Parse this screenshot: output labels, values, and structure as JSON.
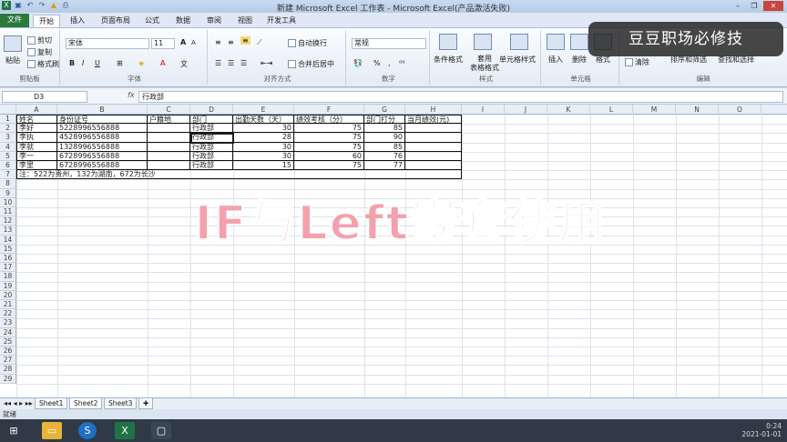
{
  "window": {
    "title": "新建 Microsoft Excel 工作表 - Microsoft Excel(产品激活失败)",
    "controls": [
      "–",
      "❐",
      "✕"
    ]
  },
  "ribbon_tabs": [
    "文件",
    "开始",
    "插入",
    "页面布局",
    "公式",
    "数据",
    "审阅",
    "视图",
    "开发工具"
  ],
  "ribbon": {
    "clipboard": {
      "paste": "粘贴",
      "cut": "剪切",
      "copy": "复制",
      "format_painter": "格式刷",
      "label": "剪贴板"
    },
    "font": {
      "name": "宋体",
      "size": "11",
      "label": "字体",
      "bold": "B",
      "italic": "I",
      "underline": "U",
      "grow": "A",
      "shrink": "A",
      "font_color": "A",
      "wen": "文"
    },
    "alignment": {
      "wrap": "自动换行",
      "merge": "合并后居中",
      "label": "对齐方式"
    },
    "number": {
      "format": "常规",
      "percent": "%",
      "comma": ",",
      "label": "数字"
    },
    "styles": {
      "cond": "条件格式",
      "table": "套用\n表格格式",
      "cell": "单元格样式",
      "label": "样式"
    },
    "cells": {
      "insert": "插入",
      "delete": "删除",
      "format": "格式",
      "label": "单元格"
    },
    "editing": {
      "clear": "清除",
      "sort": "排序和筛选",
      "find": "查找和选择",
      "label": "编辑"
    }
  },
  "formula_bar": {
    "name_box": "D3",
    "fx": "fx",
    "value": "行政部"
  },
  "columns": [
    "A",
    "B",
    "C",
    "D",
    "E",
    "F",
    "G",
    "H",
    "I",
    "J",
    "K",
    "L",
    "M",
    "N",
    "O"
  ],
  "rows": [
    "1",
    "2",
    "3",
    "4",
    "5",
    "6",
    "7",
    "8",
    "9",
    "10",
    "11",
    "12",
    "13",
    "14",
    "15",
    "16",
    "17",
    "18",
    "19",
    "20",
    "21",
    "22",
    "23",
    "24",
    "25",
    "26",
    "27",
    "28",
    "29"
  ],
  "table": {
    "headers": [
      "姓名",
      "身份证号",
      "户籍地",
      "部门",
      "出勤天数（天）",
      "绩效考核（分）",
      "部门打分",
      "当月绩效(元)"
    ],
    "rows": [
      [
        "李好",
        "5228996556888",
        "",
        "行政部",
        "30",
        "75",
        "85",
        ""
      ],
      [
        "李执",
        "4528996556888",
        "",
        "行政部",
        "28",
        "75",
        "90",
        ""
      ],
      [
        "李就",
        "1328996556888",
        "",
        "行政部",
        "30",
        "75",
        "85",
        ""
      ],
      [
        "李一",
        "6728996556888",
        "",
        "行政部",
        "30",
        "60",
        "76",
        ""
      ],
      [
        "李里",
        "6728996556888",
        "",
        "行政部",
        "15",
        "75",
        "77",
        ""
      ]
    ],
    "note": "注：522为贵州，132为湖南，672为长沙"
  },
  "sheet_tabs": [
    "Sheet1",
    "Sheet2",
    "Sheet3"
  ],
  "status": "就绪",
  "taskbar": {
    "time": "0:24",
    "date": "2021-01-01"
  },
  "watermark": "豆豆职场必修技",
  "overlay_text": "IF与Left嵌套使用"
}
